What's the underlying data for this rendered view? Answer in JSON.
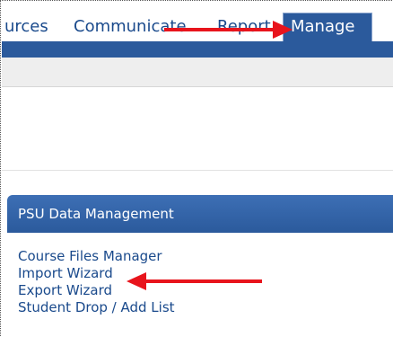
{
  "nav": {
    "tabs": [
      {
        "label": "urces"
      },
      {
        "label": "Communicate"
      },
      {
        "label": "Report"
      },
      {
        "label": "Manage"
      }
    ]
  },
  "panel": {
    "title": "PSU Data Management",
    "links": [
      {
        "label": "Course Files Manager"
      },
      {
        "label": "Import Wizard"
      },
      {
        "label": "Export Wizard"
      },
      {
        "label": "Student Drop / Add List"
      }
    ]
  },
  "colors": {
    "nav_blue": "#2b5a9c",
    "link_blue": "#1a4a8c",
    "annotation_red": "#e8141c"
  }
}
